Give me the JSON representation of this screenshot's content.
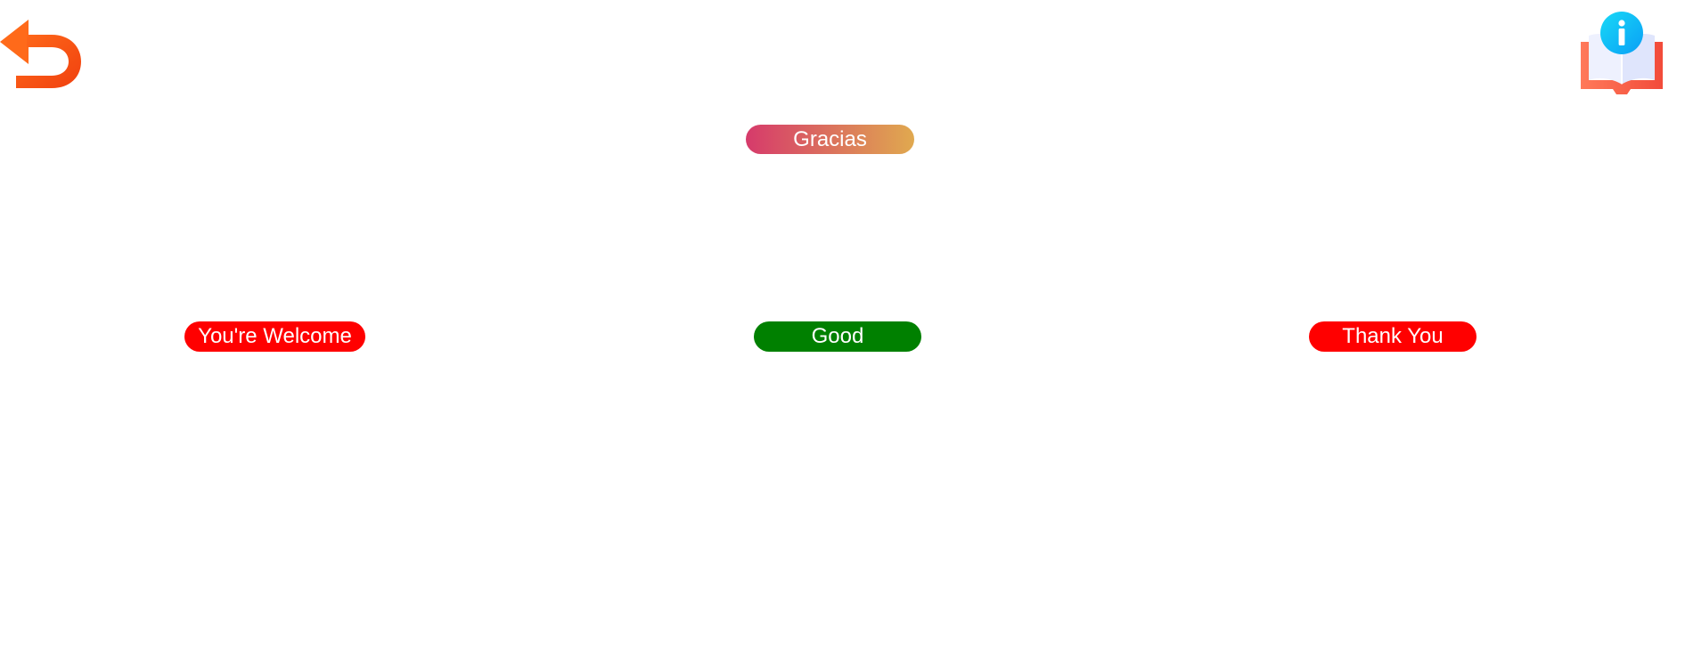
{
  "header": {
    "back_icon": "undo-arrow-icon",
    "info_icon": "book-info-icon"
  },
  "prompt": {
    "text": "Gracias",
    "gradient_start": "#d63a6b",
    "gradient_end": "#e0a94f"
  },
  "choices": [
    {
      "label": "You're Welcome",
      "color": "#ff0000"
    },
    {
      "label": "Good",
      "color": "#008000"
    },
    {
      "label": "Thank You",
      "color": "#ff0000"
    }
  ],
  "colors": {
    "back_icon_light": "#ff6a1a",
    "back_icon_dark": "#f0400f",
    "info_circle_start": "#18d9f7",
    "info_circle_end": "#0a9ff5",
    "book_cover_start": "#ff7a5a",
    "book_cover_end": "#f24b3a",
    "book_pages": "#e3e8fd"
  }
}
